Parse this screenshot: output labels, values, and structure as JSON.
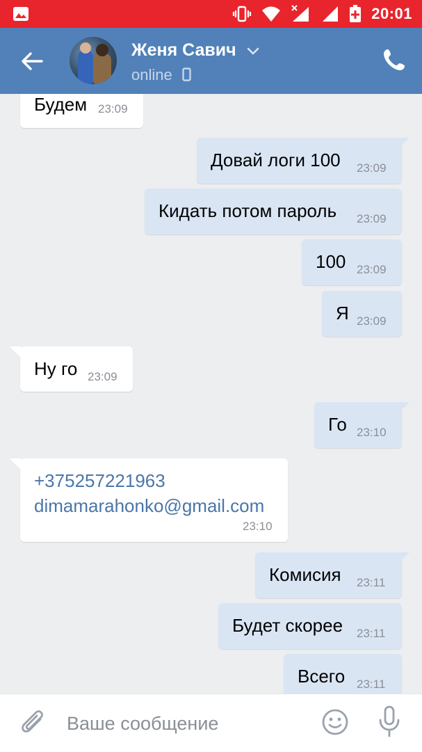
{
  "status_bar": {
    "time": "20:01",
    "icons": [
      "gallery-icon",
      "vibrate-icon",
      "wifi-icon",
      "no-signal-icon",
      "signal-icon",
      "battery-charging-icon"
    ]
  },
  "header": {
    "contact_name": "Женя Савич",
    "status": "online",
    "icons": [
      "back-arrow-icon",
      "chevron-down-icon",
      "mobile-phone-icon",
      "call-icon"
    ]
  },
  "messages": [
    {
      "direction": "in",
      "text": "Будем",
      "time": "23:09"
    },
    {
      "direction": "out",
      "text": "Довай логи 100",
      "time": "23:09"
    },
    {
      "direction": "out",
      "text": "Кидать потом пароль",
      "time": "23:09"
    },
    {
      "direction": "out",
      "text": "100",
      "time": "23:09"
    },
    {
      "direction": "out",
      "text": "Я",
      "time": "23:09"
    },
    {
      "direction": "in",
      "text": "Ну го",
      "time": "23:09"
    },
    {
      "direction": "out",
      "text": "Го",
      "time": "23:10"
    },
    {
      "direction": "in",
      "lines": [
        "+375257221963",
        "dimamarahonko@gmail.com"
      ],
      "time": "23:10"
    },
    {
      "direction": "out",
      "text": "Комисия",
      "time": "23:11"
    },
    {
      "direction": "out",
      "text": "Будет скорее",
      "time": "23:11"
    },
    {
      "direction": "out",
      "text": "Всего",
      "time": "23:11"
    }
  ],
  "composer": {
    "placeholder": "Ваше сообщение",
    "icons": [
      "paperclip-icon",
      "emoji-icon",
      "microphone-icon"
    ]
  }
}
